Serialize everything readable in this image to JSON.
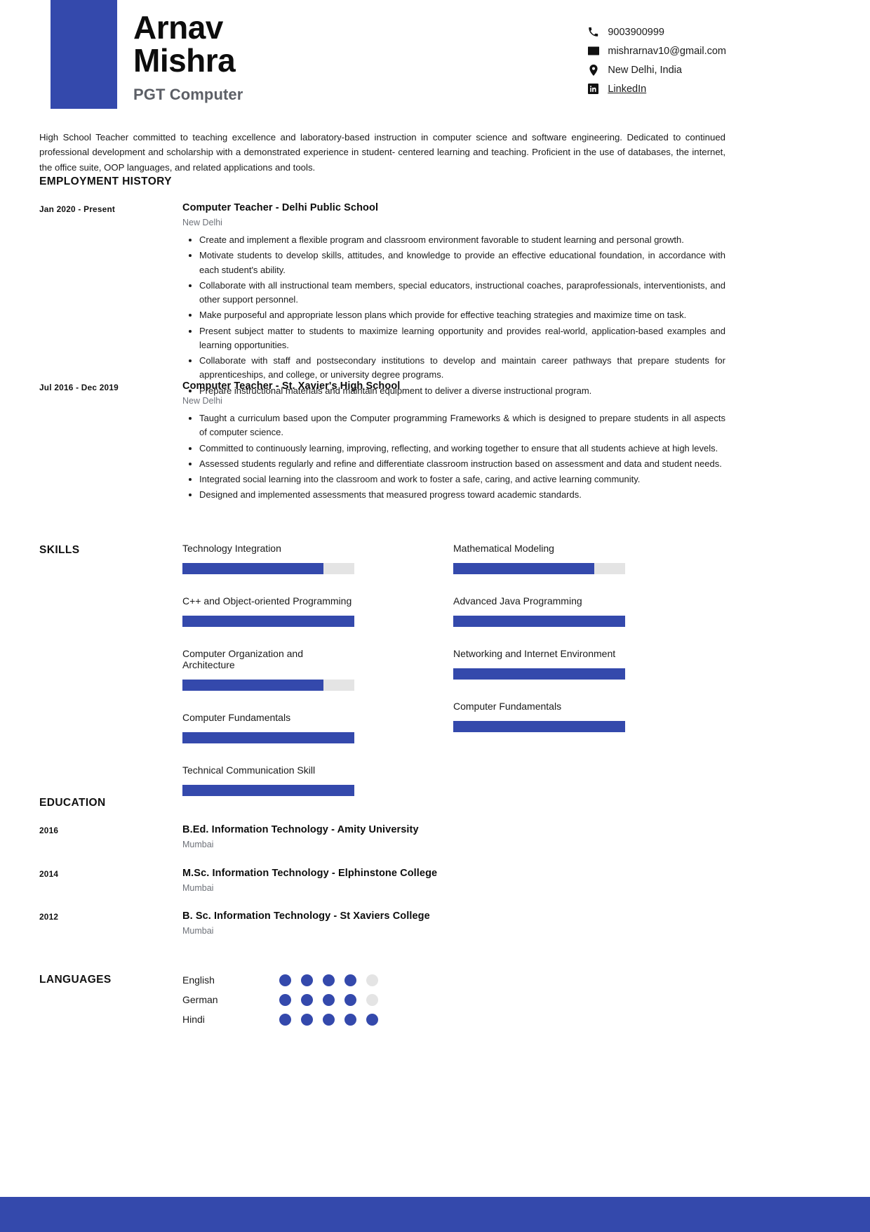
{
  "accent_color": "#3449ac",
  "track_color": "#e4e4e4",
  "header": {
    "first_name": "Arnav",
    "last_name": "Mishra",
    "job_title": "PGT Computer",
    "contacts": [
      {
        "icon": "phone-icon",
        "label": "9003900999",
        "link": false
      },
      {
        "icon": "envelope-icon",
        "label": "mishrarnav10@gmail.com",
        "link": false
      },
      {
        "icon": "location-pin-icon",
        "label": "New Delhi, India",
        "link": false
      },
      {
        "icon": "linkedin-icon",
        "label": "LinkedIn",
        "link": true
      }
    ]
  },
  "summary": "High School Teacher committed to teaching excellence and laboratory-based instruction in computer science and software engineering. Dedicated to continued professional development and scholarship with a demonstrated experience in student- centered learning and teaching. Proficient in the use of databases, the internet, the office suite, OOP languages, and related applications and tools.",
  "sections": {
    "employment_title": "EMPLOYMENT HISTORY",
    "skills_title": "SKILLS",
    "education_title": "EDUCATION",
    "languages_title": "LANGUAGES"
  },
  "employment": [
    {
      "date": "Jan 2020 - Present",
      "role": "Computer Teacher - Delhi Public School",
      "city": "New Delhi",
      "bullets": [
        "Create and implement a flexible program and classroom environment favorable to student learning and personal growth.",
        "Motivate students to develop skills, attitudes, and knowledge to provide an effective educational foundation, in accordance with each student's ability.",
        "Collaborate with all instructional team members, special educators, instructional coaches, paraprofessionals, interventionists, and other support personnel.",
        "Make purposeful and appropriate lesson plans which provide for effective teaching strategies and maximize time on task.",
        "Present subject matter to students to maximize learning opportunity and provides real-world, application-based examples and learning opportunities.",
        "Collaborate with staff and postsecondary institutions to develop and maintain career pathways that prepare students for apprenticeships, and college, or university degree programs.",
        "Prepare instructional materials and maintain equipment to deliver a diverse instructional program."
      ]
    },
    {
      "date": "Jul 2016 - Dec 2019",
      "role": "Computer Teacher - St. Xavier's High School",
      "city": "New Delhi",
      "bullets": [
        "Taught a curriculum based upon the Computer programming Frameworks & which is designed to prepare students in all aspects of computer science.",
        "Committed to continuously learning, improving, reflecting, and working together to ensure that all students achieve at high levels.",
        "Assessed students regularly and refine and differentiate classroom instruction based on assessment and data and student needs.",
        "Integrated social learning into the classroom and work to foster a safe, caring, and active learning community.",
        "Designed and implemented assessments that measured progress toward academic standards."
      ]
    }
  ],
  "skills": {
    "left": [
      {
        "name": "Technology Integration",
        "percent": 82
      },
      {
        "name": "C++ and Object-oriented Programming",
        "percent": 100
      },
      {
        "name": "Computer Organization and Architecture",
        "percent": 82
      },
      {
        "name": "Computer Fundamentals",
        "percent": 100
      },
      {
        "name": "Technical Communication Skill",
        "percent": 100
      }
    ],
    "right": [
      {
        "name": "Mathematical Modeling",
        "percent": 82
      },
      {
        "name": "Advanced Java Programming",
        "percent": 100
      },
      {
        "name": "Networking and Internet Environment",
        "percent": 100
      },
      {
        "name": "Computer Fundamentals",
        "percent": 100
      }
    ]
  },
  "education": [
    {
      "date": "2016",
      "degree": "B.Ed. Information Technology - Amity University",
      "city": "Mumbai"
    },
    {
      "date": "2014",
      "degree": "M.Sc. Information Technology - Elphinstone College",
      "city": "Mumbai"
    },
    {
      "date": "2012",
      "degree": "B. Sc. Information Technology - St Xaviers College",
      "city": "Mumbai"
    }
  ],
  "languages": [
    {
      "name": "English",
      "level": 4,
      "max": 5
    },
    {
      "name": "German",
      "level": 4,
      "max": 5
    },
    {
      "name": "Hindi",
      "level": 5,
      "max": 5
    }
  ]
}
